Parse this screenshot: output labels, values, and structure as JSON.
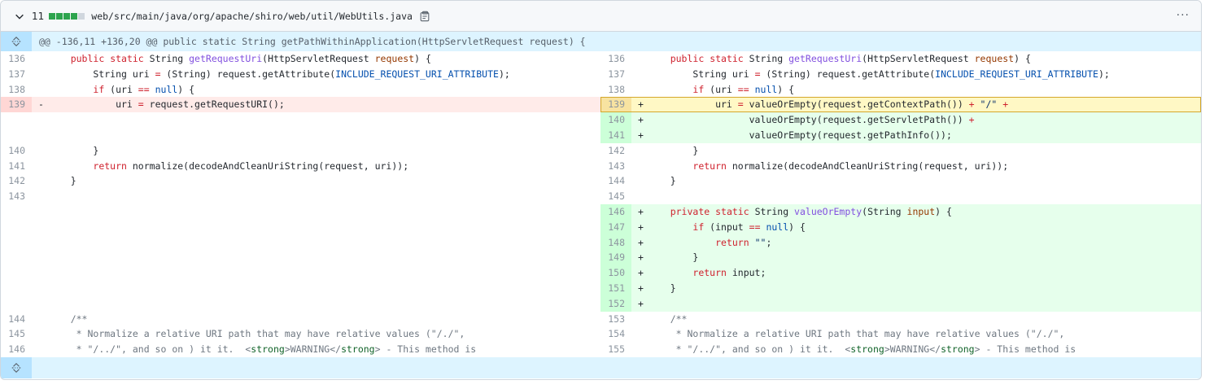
{
  "file": {
    "changes": "11",
    "path": "web/src/main/java/org/apache/shiro/web/util/WebUtils.java",
    "more": "···",
    "diffstat_colors": [
      "#2da44e",
      "#2da44e",
      "#2da44e",
      "#2da44e",
      "#d0d7de"
    ]
  },
  "hunk": {
    "header": "@@ -136,11 +136,20 @@ public static String getPathWithinApplication(HttpServletRequest request) {"
  },
  "rows": [
    {
      "l": {
        "n": "136",
        "t": "ctx",
        "code": [
          [
            "    "
          ],
          [
            "public",
            "kw"
          ],
          [
            " "
          ],
          [
            "static",
            "kw"
          ],
          [
            " String "
          ],
          [
            "getRequestUri",
            "fn"
          ],
          [
            "(HttpServletRequest "
          ],
          [
            "request",
            "pa"
          ],
          [
            ") {"
          ]
        ]
      },
      "r": {
        "n": "136",
        "t": "ctx",
        "code": [
          [
            "    "
          ],
          [
            "public",
            "kw"
          ],
          [
            " "
          ],
          [
            "static",
            "kw"
          ],
          [
            " String "
          ],
          [
            "getRequestUri",
            "fn"
          ],
          [
            "(HttpServletRequest "
          ],
          [
            "request",
            "pa"
          ],
          [
            ") {"
          ]
        ]
      }
    },
    {
      "l": {
        "n": "137",
        "t": "ctx",
        "code": [
          [
            "        String uri "
          ],
          [
            "=",
            "kw"
          ],
          [
            " (String) request.getAttribute("
          ],
          [
            "INCLUDE_REQUEST_URI_ATTRIBUTE",
            "cs"
          ],
          [
            ");"
          ]
        ]
      },
      "r": {
        "n": "137",
        "t": "ctx",
        "code": [
          [
            "        String uri "
          ],
          [
            "=",
            "kw"
          ],
          [
            " (String) request.getAttribute("
          ],
          [
            "INCLUDE_REQUEST_URI_ATTRIBUTE",
            "cs"
          ],
          [
            ");"
          ]
        ]
      }
    },
    {
      "l": {
        "n": "138",
        "t": "ctx",
        "code": [
          [
            "        "
          ],
          [
            "if",
            "kw"
          ],
          [
            " (uri "
          ],
          [
            "==",
            "kw"
          ],
          [
            " "
          ],
          [
            "null",
            "cs"
          ],
          [
            ") {"
          ]
        ]
      },
      "r": {
        "n": "138",
        "t": "ctx",
        "code": [
          [
            "        "
          ],
          [
            "if",
            "kw"
          ],
          [
            " (uri "
          ],
          [
            "==",
            "kw"
          ],
          [
            " "
          ],
          [
            "null",
            "cs"
          ],
          [
            ") {"
          ]
        ]
      }
    },
    {
      "l": {
        "n": "139",
        "t": "del",
        "m": "-",
        "code": [
          [
            "            uri "
          ],
          [
            "=",
            "kw"
          ],
          [
            " request.getRequestURI();"
          ]
        ]
      },
      "r": {
        "n": "139",
        "t": "add",
        "hl": true,
        "m": "+",
        "code": [
          [
            "            uri "
          ],
          [
            "=",
            "kw"
          ],
          [
            " valueOrEmpty(request.getContextPath()) "
          ],
          [
            "+",
            "kw"
          ],
          [
            " "
          ],
          [
            "\"/\"",
            "st"
          ],
          [
            " "
          ],
          [
            "+",
            "kw"
          ]
        ]
      }
    },
    {
      "l": {
        "t": "empty"
      },
      "r": {
        "n": "140",
        "t": "add",
        "m": "+",
        "code": [
          [
            "                  valueOrEmpty(request.getServletPath()) "
          ],
          [
            "+",
            "kw"
          ]
        ]
      }
    },
    {
      "l": {
        "t": "empty"
      },
      "r": {
        "n": "141",
        "t": "add",
        "m": "+",
        "code": [
          [
            "                  valueOrEmpty(request.getPathInfo());"
          ]
        ]
      }
    },
    {
      "l": {
        "n": "140",
        "t": "ctx",
        "code": [
          [
            "        }"
          ]
        ]
      },
      "r": {
        "n": "142",
        "t": "ctx",
        "code": [
          [
            "        }"
          ]
        ]
      }
    },
    {
      "l": {
        "n": "141",
        "t": "ctx",
        "code": [
          [
            "        "
          ],
          [
            "return",
            "kw"
          ],
          [
            " normalize(decodeAndCleanUriString(request, uri));"
          ]
        ]
      },
      "r": {
        "n": "143",
        "t": "ctx",
        "code": [
          [
            "        "
          ],
          [
            "return",
            "kw"
          ],
          [
            " normalize(decodeAndCleanUriString(request, uri));"
          ]
        ]
      }
    },
    {
      "l": {
        "n": "142",
        "t": "ctx",
        "code": [
          [
            "    }"
          ]
        ]
      },
      "r": {
        "n": "144",
        "t": "ctx",
        "code": [
          [
            "    }"
          ]
        ]
      }
    },
    {
      "l": {
        "n": "143",
        "t": "ctx",
        "code": [
          [
            ""
          ]
        ]
      },
      "r": {
        "n": "145",
        "t": "ctx",
        "code": [
          [
            ""
          ]
        ]
      }
    },
    {
      "l": {
        "t": "empty"
      },
      "r": {
        "n": "146",
        "t": "add",
        "m": "+",
        "code": [
          [
            "    "
          ],
          [
            "private",
            "kw"
          ],
          [
            " "
          ],
          [
            "static",
            "kw"
          ],
          [
            " String "
          ],
          [
            "valueOrEmpty",
            "fn"
          ],
          [
            "(String "
          ],
          [
            "input",
            "pa"
          ],
          [
            ") {"
          ]
        ]
      }
    },
    {
      "l": {
        "t": "empty"
      },
      "r": {
        "n": "147",
        "t": "add",
        "m": "+",
        "code": [
          [
            "        "
          ],
          [
            "if",
            "kw"
          ],
          [
            " (input "
          ],
          [
            "==",
            "kw"
          ],
          [
            " "
          ],
          [
            "null",
            "cs"
          ],
          [
            ") {"
          ]
        ]
      }
    },
    {
      "l": {
        "t": "empty"
      },
      "r": {
        "n": "148",
        "t": "add",
        "m": "+",
        "code": [
          [
            "            "
          ],
          [
            "return",
            "kw"
          ],
          [
            " "
          ],
          [
            "\"\"",
            "st"
          ],
          [
            ";"
          ]
        ]
      }
    },
    {
      "l": {
        "t": "empty"
      },
      "r": {
        "n": "149",
        "t": "add",
        "m": "+",
        "code": [
          [
            "        }"
          ]
        ]
      }
    },
    {
      "l": {
        "t": "empty"
      },
      "r": {
        "n": "150",
        "t": "add",
        "m": "+",
        "code": [
          [
            "        "
          ],
          [
            "return",
            "kw"
          ],
          [
            " input;"
          ]
        ]
      }
    },
    {
      "l": {
        "t": "empty"
      },
      "r": {
        "n": "151",
        "t": "add",
        "m": "+",
        "code": [
          [
            "    }"
          ]
        ]
      }
    },
    {
      "l": {
        "t": "empty"
      },
      "r": {
        "n": "152",
        "t": "add",
        "m": "+",
        "code": [
          [
            ""
          ]
        ]
      }
    },
    {
      "l": {
        "n": "144",
        "t": "ctx",
        "code": [
          [
            "    "
          ],
          [
            "/**",
            "cm"
          ]
        ]
      },
      "r": {
        "n": "153",
        "t": "ctx",
        "code": [
          [
            "    "
          ],
          [
            "/**",
            "cm"
          ]
        ]
      }
    },
    {
      "l": {
        "n": "145",
        "t": "ctx",
        "code": [
          [
            "     "
          ],
          [
            "* Normalize a relative URI path that may have relative values (\"/./\",",
            "cm"
          ]
        ]
      },
      "r": {
        "n": "154",
        "t": "ctx",
        "code": [
          [
            "     "
          ],
          [
            "* Normalize a relative URI path that may have relative values (\"/./\",",
            "cm"
          ]
        ]
      }
    },
    {
      "l": {
        "n": "146",
        "t": "ctx",
        "code": [
          [
            "     "
          ],
          [
            "* \"/../\", and so on ) it it.  <",
            "cm"
          ],
          [
            "strong",
            "tg"
          ],
          [
            ">WARNING</",
            "cm"
          ],
          [
            "strong",
            "tg"
          ],
          [
            "> - This method is",
            "cm"
          ]
        ]
      },
      "r": {
        "n": "155",
        "t": "ctx",
        "code": [
          [
            "     "
          ],
          [
            "* \"/../\", and so on ) it it.  <",
            "cm"
          ],
          [
            "strong",
            "tg"
          ],
          [
            ">WARNING</",
            "cm"
          ],
          [
            "strong",
            "tg"
          ],
          [
            "> - This method is",
            "cm"
          ]
        ]
      }
    }
  ]
}
